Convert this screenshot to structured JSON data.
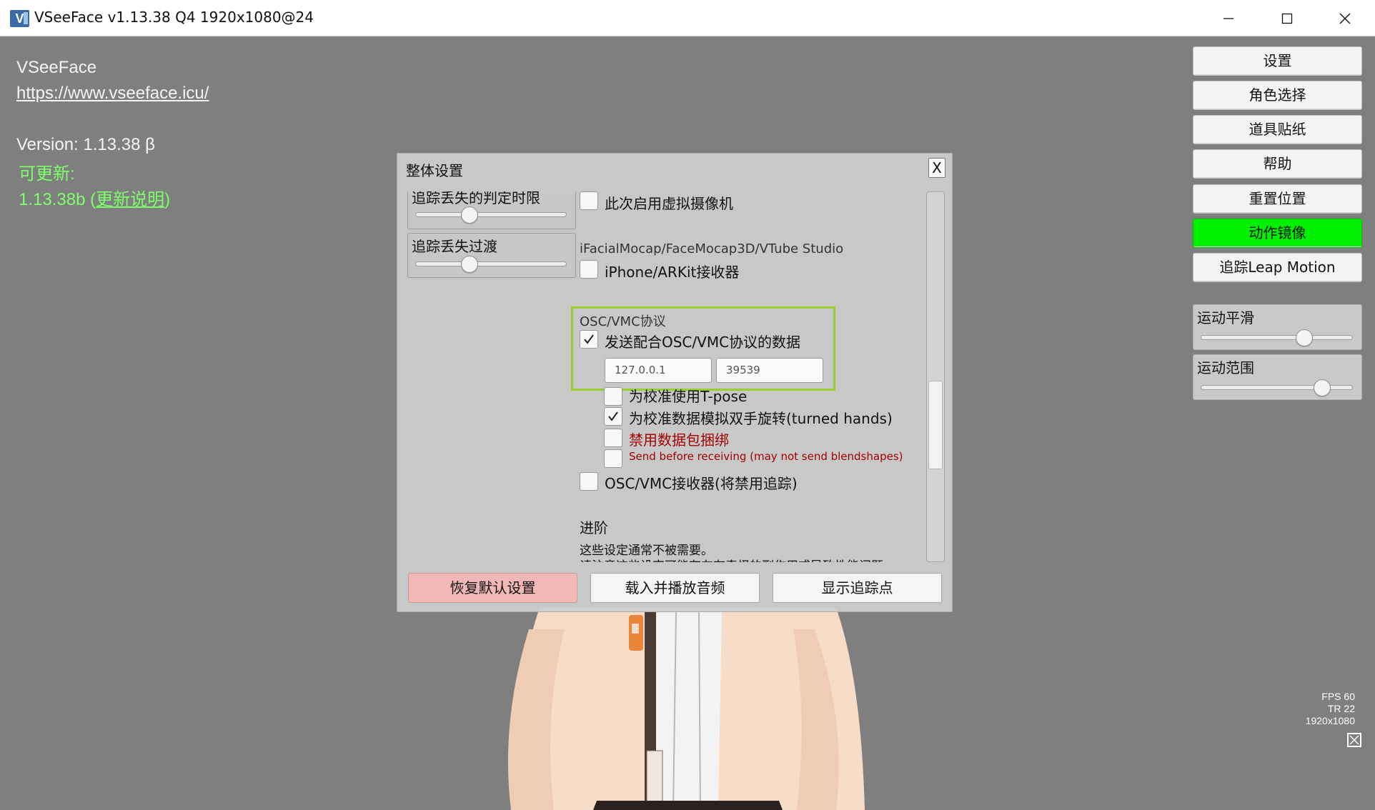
{
  "window": {
    "title": "VSeeFace v1.13.38 Q4 1920x1080@24",
    "icon_glyph": "V"
  },
  "info": {
    "app_name": "VSeeFace",
    "url": "https://www.vseeface.icu/",
    "version": "Version: 1.13.38 β",
    "update_available": "可更新:",
    "update_version_prefix": "1.13.38b (",
    "update_notes": "更新说明",
    "update_version_suffix": ")"
  },
  "side_buttons": {
    "settings": "设置",
    "character_select": "角色选择",
    "props_stickers": "道具贴纸",
    "help": "帮助",
    "reset_position": "重置位置",
    "motion_mirror": "动作镜像",
    "leap_motion": "追踪Leap Motion"
  },
  "side_sliders": {
    "motion_smoothing": {
      "label": "运动平滑",
      "value": 0.68
    },
    "motion_range": {
      "label": "运动范围",
      "value": 0.8
    }
  },
  "stats": {
    "fps": "FPS 60",
    "tr": "TR   22",
    "resolution": "1920x1080"
  },
  "dialog": {
    "title": "整体设置",
    "close_label": "X",
    "tracking_loss_threshold": {
      "label": "追踪丢失的判定时限",
      "value": 0.36
    },
    "tracking_loss_transition": {
      "label": "追踪丢失过渡",
      "value": 0.36
    },
    "enable_virtual_camera": {
      "label": "此次启用虚拟摄像机",
      "checked": false
    },
    "ifacial_header": "iFacialMocap/FaceMocap3D/VTube Studio",
    "iphone_receiver": {
      "label": "iPhone/ARKit接收器",
      "checked": false
    },
    "osc_header": "OSC/VMC协议",
    "osc_send": {
      "label": "发送配合OSC/VMC协议的数据",
      "checked": true
    },
    "osc_ip": "127.0.0.1",
    "osc_port": "39539",
    "tpose": {
      "label": "为校准使用T-pose",
      "checked": false
    },
    "turned_hands": {
      "label": "为校准数据模拟双手旋转(turned hands)",
      "checked": true
    },
    "disable_bundling": {
      "label": "禁用数据包捆绑",
      "checked": false
    },
    "send_before_receiving": {
      "label": "Send before receiving (may not send blendshapes)",
      "checked": false
    },
    "osc_receiver": {
      "label": "OSC/VMC接收器(将禁用追踪)",
      "checked": false
    },
    "advanced_header": "进阶",
    "advanced_note": "这些设定通常不被需要。",
    "advanced_warning": "请注意这些设定可能存在有奇怪的副作用或导致性能问题",
    "restore_defaults": "恢复默认设置",
    "load_audio": "载入并播放音频",
    "show_tracking_points": "显示追踪点"
  },
  "colors": {
    "viewport_bg": "#7f7f7f",
    "active_button": "#00f000",
    "update_text": "#7dff6a",
    "highlight_frame": "#9acd32",
    "restore_button": "#f2b7b7",
    "warning_text": "#a30000"
  }
}
